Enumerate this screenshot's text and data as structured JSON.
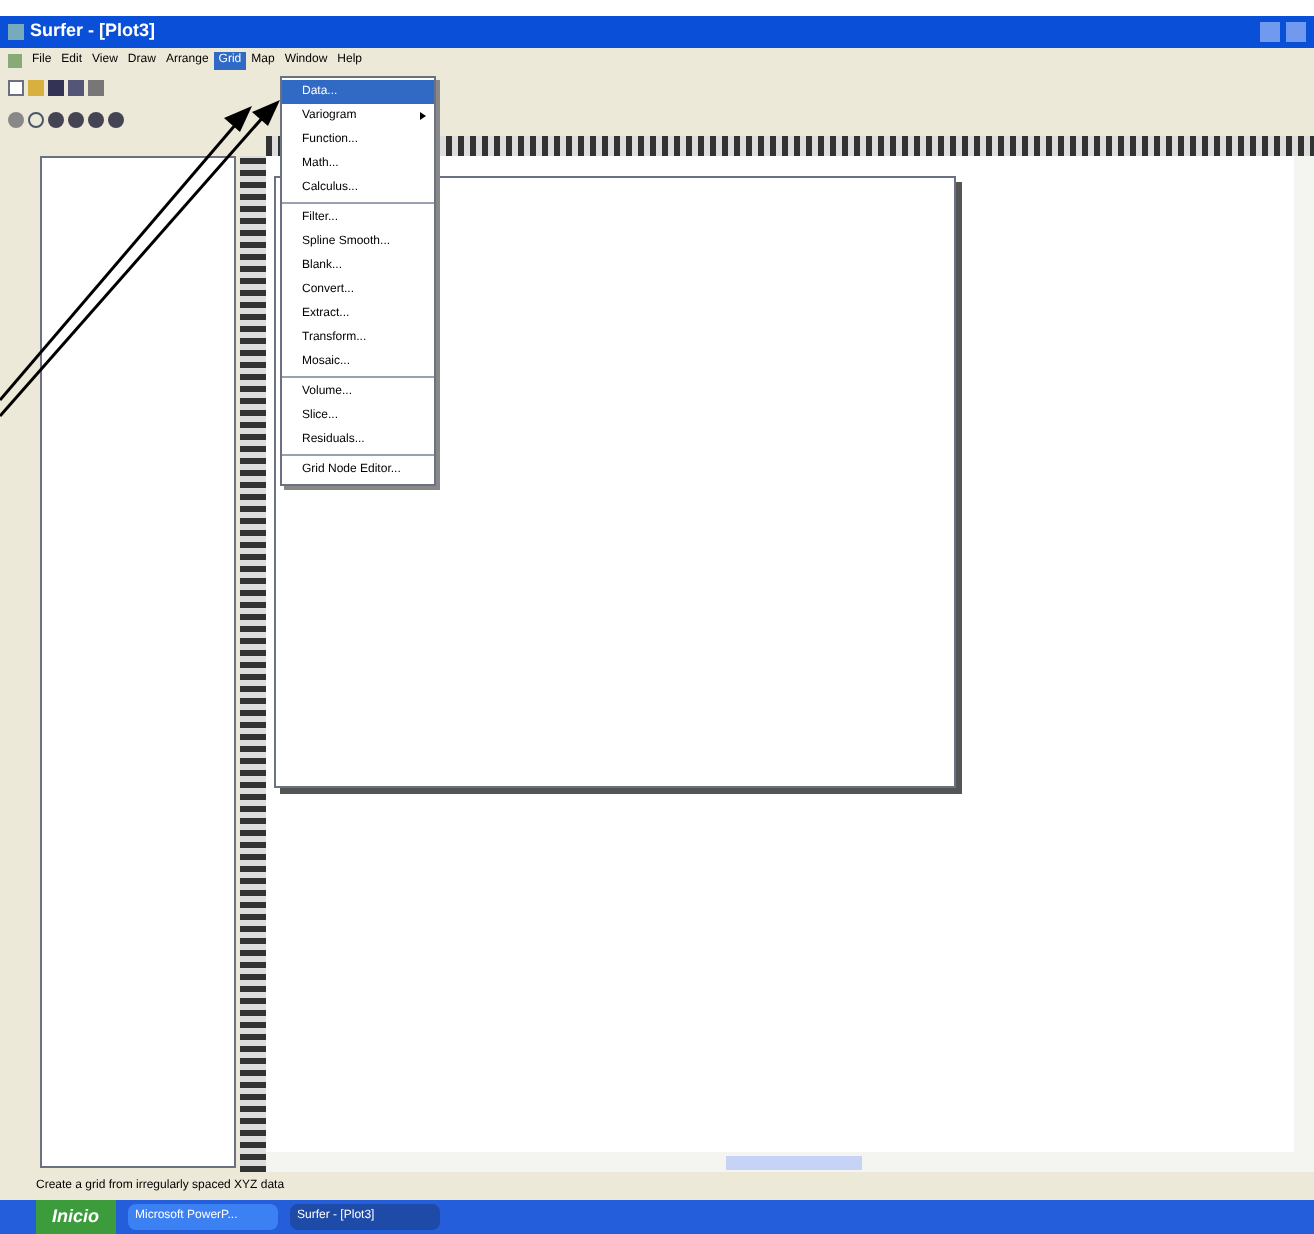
{
  "window": {
    "title": "Surfer - [Plot3]"
  },
  "menu_bar": [
    {
      "label": "File",
      "selected": false
    },
    {
      "label": "Edit",
      "selected": false
    },
    {
      "label": "View",
      "selected": false
    },
    {
      "label": "Draw",
      "selected": false
    },
    {
      "label": "Arrange",
      "selected": false
    },
    {
      "label": "Grid",
      "selected": true
    },
    {
      "label": "Map",
      "selected": false
    },
    {
      "label": "Window",
      "selected": false
    },
    {
      "label": "Help",
      "selected": false
    }
  ],
  "grid_menu": [
    {
      "kind": "item",
      "label": "Data...",
      "selected": true,
      "submenu": false
    },
    {
      "kind": "item",
      "label": "Variogram",
      "selected": false,
      "submenu": true
    },
    {
      "kind": "item",
      "label": "Function...",
      "selected": false,
      "submenu": false
    },
    {
      "kind": "item",
      "label": "Math...",
      "selected": false,
      "submenu": false
    },
    {
      "kind": "item",
      "label": "Calculus...",
      "selected": false,
      "submenu": false
    },
    {
      "kind": "separator"
    },
    {
      "kind": "item",
      "label": "Filter...",
      "selected": false,
      "submenu": false
    },
    {
      "kind": "item",
      "label": "Spline Smooth...",
      "selected": false,
      "submenu": false
    },
    {
      "kind": "item",
      "label": "Blank...",
      "selected": false,
      "submenu": false
    },
    {
      "kind": "item",
      "label": "Convert...",
      "selected": false,
      "submenu": false
    },
    {
      "kind": "item",
      "label": "Extract...",
      "selected": false,
      "submenu": false
    },
    {
      "kind": "item",
      "label": "Transform...",
      "selected": false,
      "submenu": false
    },
    {
      "kind": "item",
      "label": "Mosaic...",
      "selected": false,
      "submenu": false
    },
    {
      "kind": "separator"
    },
    {
      "kind": "item",
      "label": "Volume...",
      "selected": false,
      "submenu": false
    },
    {
      "kind": "item",
      "label": "Slice...",
      "selected": false,
      "submenu": false
    },
    {
      "kind": "item",
      "label": "Residuals...",
      "selected": false,
      "submenu": false
    },
    {
      "kind": "separator"
    },
    {
      "kind": "item",
      "label": "Grid Node Editor...",
      "selected": false,
      "submenu": false
    }
  ],
  "status_bar": "Create a grid from irregularly spaced XYZ data",
  "taskbar": {
    "start": "Inicio",
    "tasks": [
      {
        "label": "Microsoft PowerP...",
        "selected": false
      },
      {
        "label": "Surfer - [Plot3]",
        "selected": true
      }
    ]
  }
}
